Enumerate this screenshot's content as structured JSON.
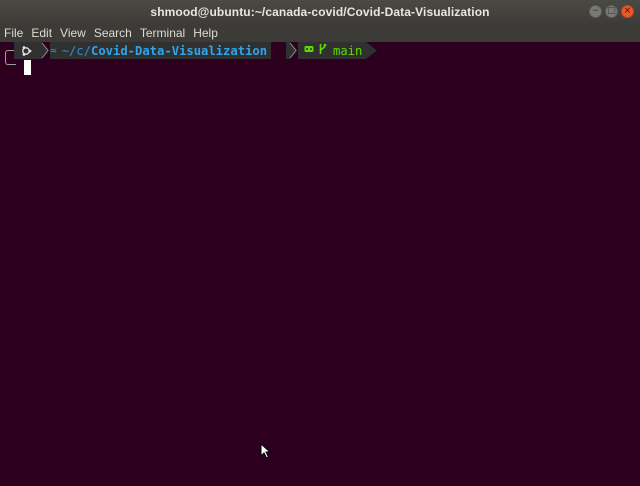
{
  "window": {
    "title": "shmood@ubuntu:~/canada-covid/Covid-Data-Visualization",
    "controls": {
      "minimize": "−",
      "maximize": "□",
      "close": "×"
    }
  },
  "menu": {
    "items": [
      "File",
      "Edit",
      "View",
      "Search",
      "Terminal",
      "Help"
    ]
  },
  "prompt": {
    "os_icon": "ubuntu-icon",
    "dir_icon": "folder-icon",
    "path_prefix": "~/c/",
    "path_dir": "Covid-Data-Visualization",
    "git_icon": "git-icon",
    "branch_icon": "branch-icon",
    "branch": "main"
  },
  "colors": {
    "background": "#2C001E",
    "path": "#2FA5EE",
    "git": "#5FD700",
    "segment_bg": "#303030"
  }
}
